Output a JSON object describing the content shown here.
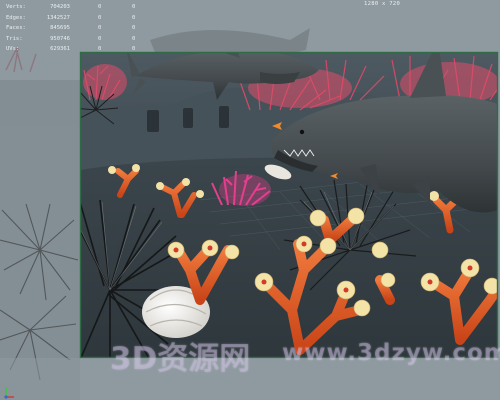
{
  "hud": {
    "stats": [
      {
        "label": "Verts:",
        "value": "704203",
        "col2": "0",
        "col3": "0"
      },
      {
        "label": "Edges:",
        "value": "1342527",
        "col2": "0",
        "col3": "0"
      },
      {
        "label": "Faces:",
        "value": "845695",
        "col2": "0",
        "col3": "0"
      },
      {
        "label": "Tris:",
        "value": "950746",
        "col2": "0",
        "col3": "0"
      },
      {
        "label": "UVs:",
        "value": "629361",
        "col2": "0",
        "col3": "0"
      }
    ],
    "resolution": "1280 x 720"
  },
  "watermarks": {
    "left": "3D资源网",
    "right": "www.3dzyw.com"
  },
  "colors": {
    "viewport_bg": "#8f9aa0",
    "gate_border": "#2f6b45",
    "coral_orange": "#e8602a",
    "coral_pink": "#e43f8e",
    "shark": "#4c5356"
  },
  "icons": {
    "axis": "axis-indicator-icon"
  }
}
